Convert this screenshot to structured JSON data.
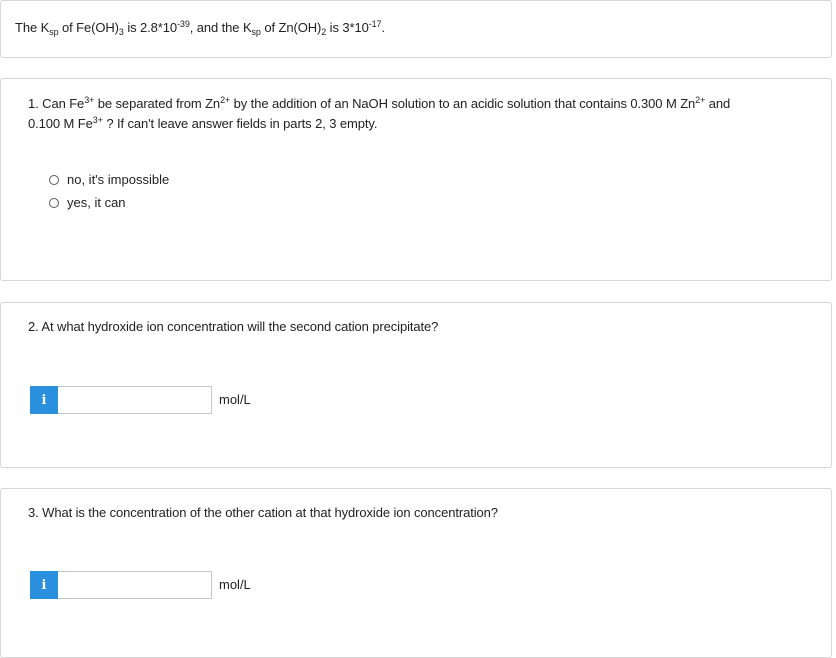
{
  "intro": {
    "t1": "The K",
    "t1_sub": "sp",
    "t2": " of Fe(OH)",
    "t2_sub": "3",
    "t3": " is 2.8*10",
    "t3_sup": "-39",
    "t4": ", and the K",
    "t4_sub": "sp",
    "t5": " of Zn(OH)",
    "t5_sub": "2",
    "t6": " is 3*10",
    "t6_sup": "-17",
    "t7": "."
  },
  "q1": {
    "l1_a": "1. Can Fe",
    "l1_a_sup": "3+",
    "l1_b": " be separated from Zn",
    "l1_b_sup": "2+",
    "l1_c": " by the addition of an NaOH solution to an acidic solution that contains 0.300 M Zn",
    "l1_c_sup": "2+",
    "l1_d": " and",
    "l2_a": "0.100 M Fe",
    "l2_a_sup": "3+",
    "l2_b": " ? If can't leave answer fields in parts 2, 3 empty.",
    "options": [
      {
        "label": "no, it's impossible"
      },
      {
        "label": "yes, it can"
      }
    ]
  },
  "q2": {
    "text": "2. At what hydroxide ion concentration will the second cation precipitate?",
    "info_label": "i",
    "input_value": "",
    "unit": "mol/L"
  },
  "q3": {
    "text": "3. What is the concentration of the other cation at that hydroxide ion concentration?",
    "info_label": "i",
    "input_value": "",
    "unit": "mol/L"
  },
  "colors": {
    "info_button": "#2a8fdd",
    "card_border": "#d6d6d6"
  },
  "icons": {
    "info": "info-icon"
  }
}
